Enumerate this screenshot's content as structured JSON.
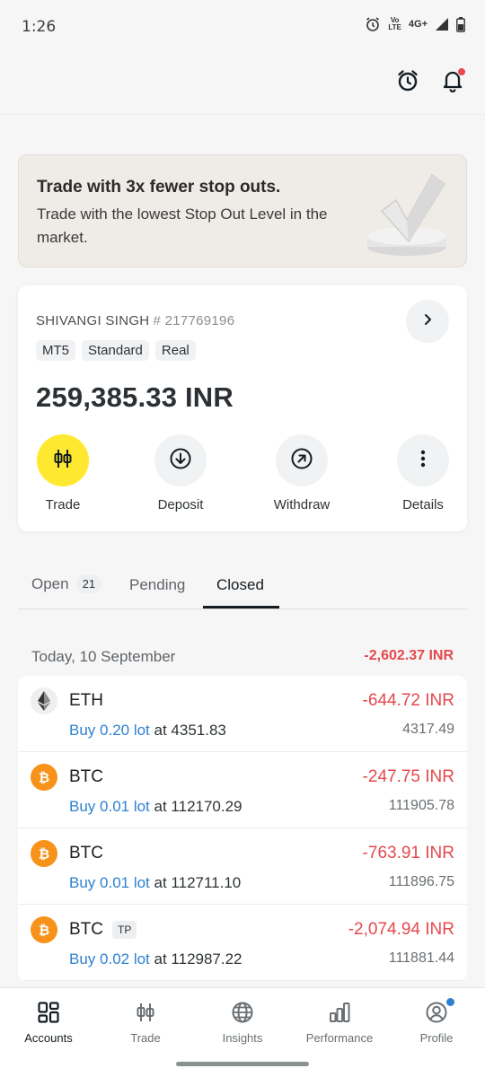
{
  "status_bar": {
    "time": "1:26",
    "volte_top": "Vo",
    "volte_bottom": "LTE",
    "network": "4G+"
  },
  "top_bar": {
    "alarm_icon": "alarm-clock-icon",
    "notification_icon": "bell-icon",
    "has_notification": true
  },
  "promo": {
    "title": "Trade with 3x fewer stop outs.",
    "text": "Trade with the lowest Stop Out Level in the market."
  },
  "account": {
    "name": "SHIVANGI SINGH",
    "number": "# 217769196",
    "tags": [
      "MT5",
      "Standard",
      "Real"
    ],
    "balance": "259,385.33 INR",
    "actions": {
      "trade": "Trade",
      "deposit": "Deposit",
      "withdraw": "Withdraw",
      "details": "Details"
    }
  },
  "tabs": {
    "open": "Open",
    "open_count": "21",
    "pending": "Pending",
    "closed": "Closed",
    "active": "Closed"
  },
  "day": {
    "label": "Today, 10 September",
    "total": "-2,602.37 INR"
  },
  "trades": [
    {
      "symbol": "ETH",
      "badge": "",
      "side": "Buy 0.20 lot",
      "at": "at 4351.83",
      "pl": "-644.72 INR",
      "close": "4317.49",
      "coin": "eth"
    },
    {
      "symbol": "BTC",
      "badge": "",
      "side": "Buy 0.01 lot",
      "at": "at 112170.29",
      "pl": "-247.75 INR",
      "close": "111905.78",
      "coin": "btc"
    },
    {
      "symbol": "BTC",
      "badge": "",
      "side": "Buy 0.01 lot",
      "at": "at 112711.10",
      "pl": "-763.91 INR",
      "close": "111896.75",
      "coin": "btc"
    },
    {
      "symbol": "BTC",
      "badge": "TP",
      "side": "Buy 0.02 lot",
      "at": "at 112987.22",
      "pl": "-2,074.94 INR",
      "close": "111881.44",
      "coin": "btc"
    }
  ],
  "bottom_nav": {
    "accounts": "Accounts",
    "trade": "Trade",
    "insights": "Insights",
    "performance": "Performance",
    "profile": "Profile",
    "active": "Accounts"
  },
  "colors": {
    "negative": "#e5484d",
    "link_blue": "#2e80d0",
    "trade_yellow": "#ffe930",
    "btc_orange": "#f7931a"
  }
}
